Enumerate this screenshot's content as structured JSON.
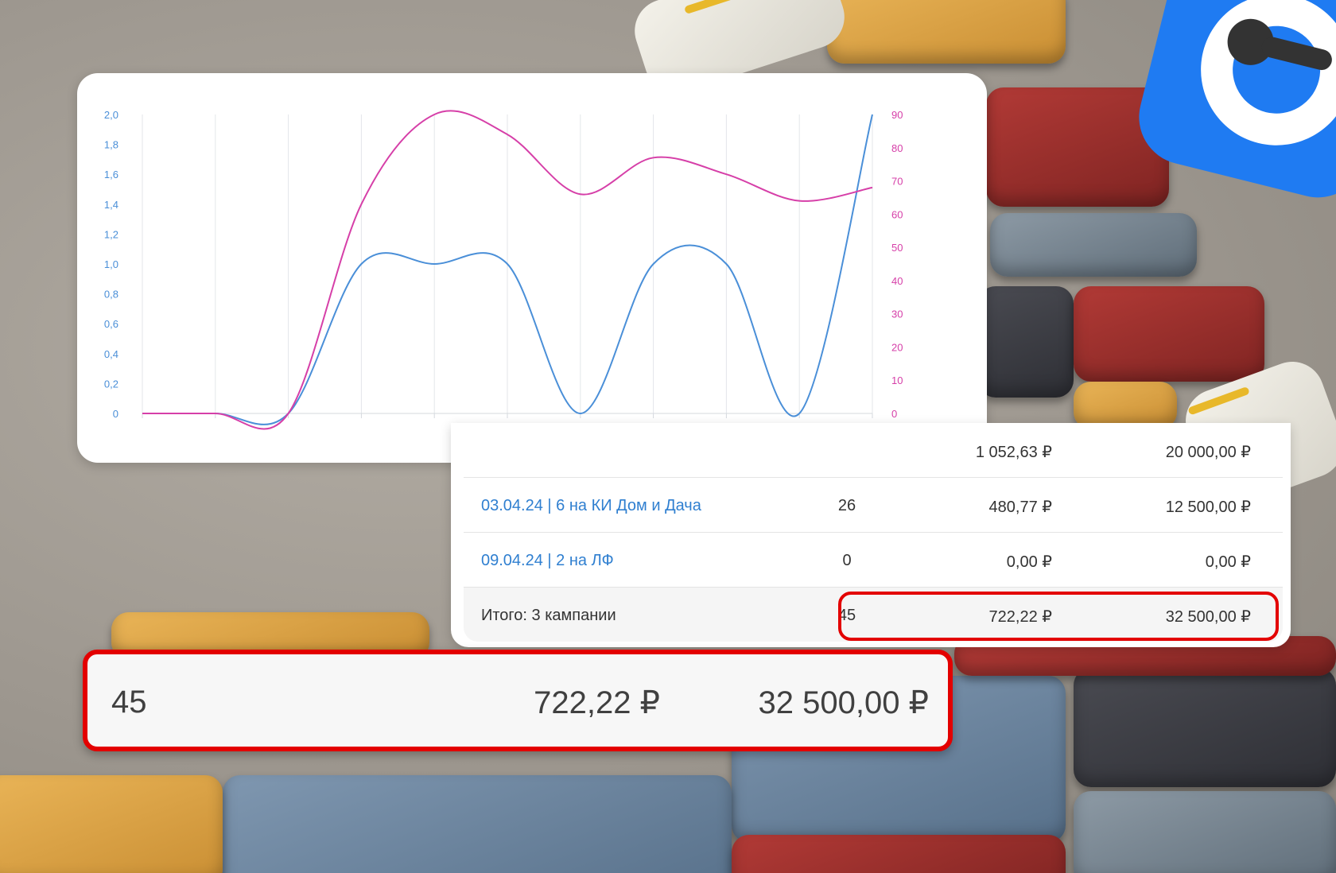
{
  "chart_data": {
    "type": "line",
    "x": [
      1,
      2,
      3,
      4,
      5,
      6,
      7,
      8,
      9,
      10,
      11
    ],
    "series": [
      {
        "axis": "left",
        "color": "#4a8fd8",
        "values": [
          0,
          0,
          0,
          1.0,
          1.0,
          1.0,
          0,
          1.0,
          1.0,
          0,
          2.0
        ]
      },
      {
        "axis": "right",
        "color": "#d63fa8",
        "values": [
          0,
          0,
          0,
          63,
          90,
          84,
          66,
          77,
          72,
          64,
          68
        ]
      }
    ],
    "y_left": {
      "ticks": [
        "0",
        "0,2",
        "0,4",
        "0,6",
        "0,8",
        "1,0",
        "1,2",
        "1,4",
        "1,6",
        "1,8",
        "2,0"
      ],
      "range": [
        0,
        2.0
      ],
      "color": "#4a8fd8"
    },
    "y_right": {
      "ticks": [
        "0",
        "10",
        "20",
        "30",
        "40",
        "50",
        "60",
        "70",
        "80",
        "90"
      ],
      "range": [
        0,
        90
      ],
      "color": "#d63fa8"
    },
    "grid": "vertical"
  },
  "table": {
    "rows": [
      {
        "name": "",
        "count": "",
        "cpa": "1 052,63 ₽",
        "sum": "20 000,00 ₽"
      },
      {
        "name": "03.04.24 | 6 на КИ Дом и Дача",
        "count": "26",
        "cpa": "480,77 ₽",
        "sum": "12 500,00 ₽"
      },
      {
        "name": "09.04.24 | 2 на ЛФ",
        "count": "0",
        "cpa": "0,00 ₽",
        "sum": "0,00 ₽"
      }
    ],
    "total": {
      "label": "Итого: 3 кампании",
      "count": "45",
      "cpa": "722,22 ₽",
      "sum": "32 500,00 ₽"
    }
  },
  "zoom": {
    "count": "45",
    "cpa": "722,22 ₽",
    "sum": "32 500,00 ₽"
  }
}
